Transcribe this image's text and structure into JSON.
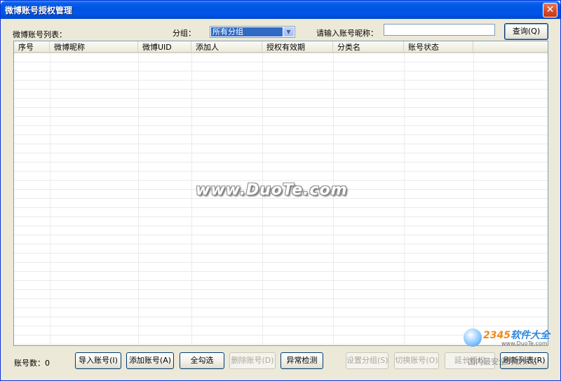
{
  "window": {
    "title": "微博账号授权管理",
    "close_glyph": "✕"
  },
  "top": {
    "list_label": "微博账号列表：",
    "group_label": "分组：",
    "group_select": {
      "value": "所有分组",
      "arrow": "▼"
    },
    "search_label": "请输入账号昵称：",
    "search_value": "",
    "query_button": "查询(Q)"
  },
  "grid": {
    "columns": [
      "序号",
      "微博昵称",
      "微博UID",
      "添加人",
      "授权有效期",
      "分类名",
      "账号状态",
      ""
    ],
    "rows": []
  },
  "footer": {
    "count_label": "账号数：0",
    "buttons": [
      {
        "label": "导入账号(I)",
        "enabled": true
      },
      {
        "label": "添加账号(A)",
        "enabled": true
      },
      {
        "label": "全勾选",
        "enabled": true
      },
      {
        "label": "删除账号(D)",
        "enabled": false
      },
      {
        "label": "异常检测",
        "enabled": true
      },
      {
        "label": "设置分组(S)",
        "enabled": false
      },
      {
        "label": "切换账号(O)",
        "enabled": false
      },
      {
        "label": "延长授权",
        "enabled": false
      },
      {
        "label": "刷新列表(R)",
        "enabled": true
      }
    ]
  },
  "watermark": {
    "text": "www.DuoTe.com",
    "logo_brand_a": "2345",
    "logo_brand_b": "软件大全",
    "logo_url": "www.DuoTe.com",
    "overlay_text": "国内最安全的软件站"
  }
}
